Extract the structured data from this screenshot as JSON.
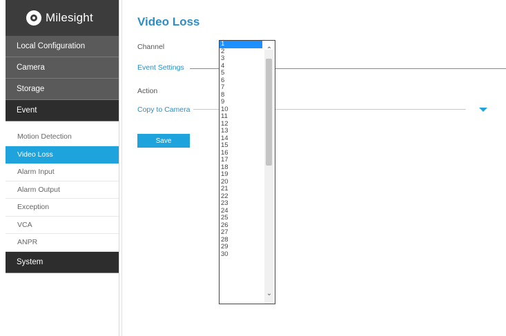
{
  "brand": {
    "name": "Milesight"
  },
  "sidebar": {
    "top_items": [
      {
        "label": "Local Configuration"
      },
      {
        "label": "Camera"
      },
      {
        "label": "Storage"
      },
      {
        "label": "Event"
      }
    ],
    "sub_items": [
      {
        "label": "Motion Detection"
      },
      {
        "label": "Video Loss"
      },
      {
        "label": "Alarm Input"
      },
      {
        "label": "Alarm Output"
      },
      {
        "label": "Exception"
      },
      {
        "label": "VCA"
      },
      {
        "label": "ANPR"
      }
    ],
    "bottom_items": [
      {
        "label": "System"
      }
    ],
    "active_sub": "Video Loss"
  },
  "page": {
    "title": "Video Loss",
    "channel_label": "Channel",
    "event_settings_label": "Event Settings",
    "action_label": "Action",
    "copy_to_camera_label": "Copy to Camera",
    "save_label": "Save"
  },
  "channel_dropdown": {
    "selected": "1",
    "options": [
      "1",
      "2",
      "3",
      "4",
      "5",
      "6",
      "7",
      "8",
      "9",
      "10",
      "11",
      "12",
      "13",
      "14",
      "15",
      "16",
      "17",
      "18",
      "19",
      "20",
      "21",
      "22",
      "23",
      "24",
      "25",
      "26",
      "27",
      "28",
      "29",
      "30"
    ]
  },
  "colors": {
    "accent": "#1fa3dc",
    "sidebar_dark": "#3c3c3c"
  }
}
